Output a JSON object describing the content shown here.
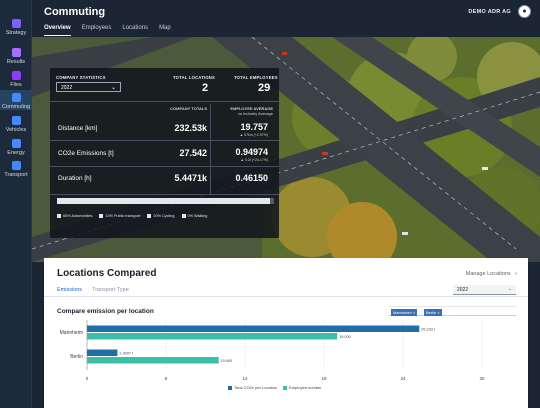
{
  "app": {
    "title": "Commuting",
    "company": "DEMO ADR AG"
  },
  "sidebar": {
    "items": [
      {
        "label": "Strategy",
        "icon": "strategy-icon",
        "color": "#7b61ff"
      },
      {
        "label": "Results",
        "icon": "results-icon",
        "color": "#a56eff"
      },
      {
        "label": "Files",
        "icon": "files-icon",
        "color": "#8a3ffc"
      },
      {
        "label": "Commuting",
        "icon": "commuting-icon",
        "color": "#4589ff"
      },
      {
        "label": "Vehicles",
        "icon": "vehicles-icon",
        "color": "#4589ff"
      },
      {
        "label": "Energy",
        "icon": "energy-icon",
        "color": "#4589ff"
      },
      {
        "label": "Transport",
        "icon": "transport-icon",
        "color": "#4589ff"
      }
    ]
  },
  "tabs": [
    "Overview",
    "Employees",
    "Locations",
    "Map"
  ],
  "stats": {
    "company_statistics_label": "COMPANY STATISTICS",
    "year": "2022",
    "total_locations_label": "TOTAL LOCATIONS",
    "total_locations": "2",
    "total_employees_label": "TOTAL EMPLOYEES",
    "total_employees": "29",
    "company_totals_label": "COMPANY TOTALS",
    "employee_average_label": "EMPLOYEE AVERAGE",
    "vs_industry_label": "vs Industry Average",
    "rows": [
      {
        "label": "Distance [km]",
        "total": "232.53k",
        "avg": "19.757",
        "sub": "▲ 57km (+2.97%)"
      },
      {
        "label": "CO2e Emissions [t]",
        "total": "27.542",
        "avg": "0.94974",
        "sub": "▲ 0.2t (+24.17%)"
      },
      {
        "label": "Duration [h]",
        "total": "5.4471k",
        "avg": "0.46150",
        "sub": ""
      }
    ],
    "modal_split": [
      {
        "label": "65% Automobiles",
        "value": 65
      },
      {
        "label": "13% Public transport",
        "value": 13
      },
      {
        "label": "20% Cycling",
        "value": 20
      },
      {
        "label": "0% Walking",
        "value": 0
      }
    ]
  },
  "locations_card": {
    "title": "Locations Compared",
    "manage_label": "Manage Locations",
    "tabs": [
      "Emissions",
      "Transport Type"
    ],
    "year": "2022",
    "chart_title": "Compare emission per location",
    "filter_chips": [
      "Mannheim",
      "Berlin"
    ]
  },
  "chart_data": {
    "type": "bar",
    "orientation": "horizontal",
    "categories": [
      "Mannheim",
      "Berlin"
    ],
    "series": [
      {
        "name": "Tons CO2e per Location",
        "values": [
          25.233,
          2.3097
        ],
        "labels": [
          "25.233 t",
          "2.3097 t"
        ],
        "color": "#1f6ea8"
      },
      {
        "name": "Employee number",
        "values": [
          19,
          10
        ],
        "labels": [
          "19.000",
          "10.000"
        ],
        "color": "#3bbfa8"
      }
    ],
    "xlim": [
      0,
      30
    ],
    "xticks": [
      0,
      6,
      12,
      18,
      24,
      30
    ],
    "grid": true,
    "legend": "bottom"
  }
}
